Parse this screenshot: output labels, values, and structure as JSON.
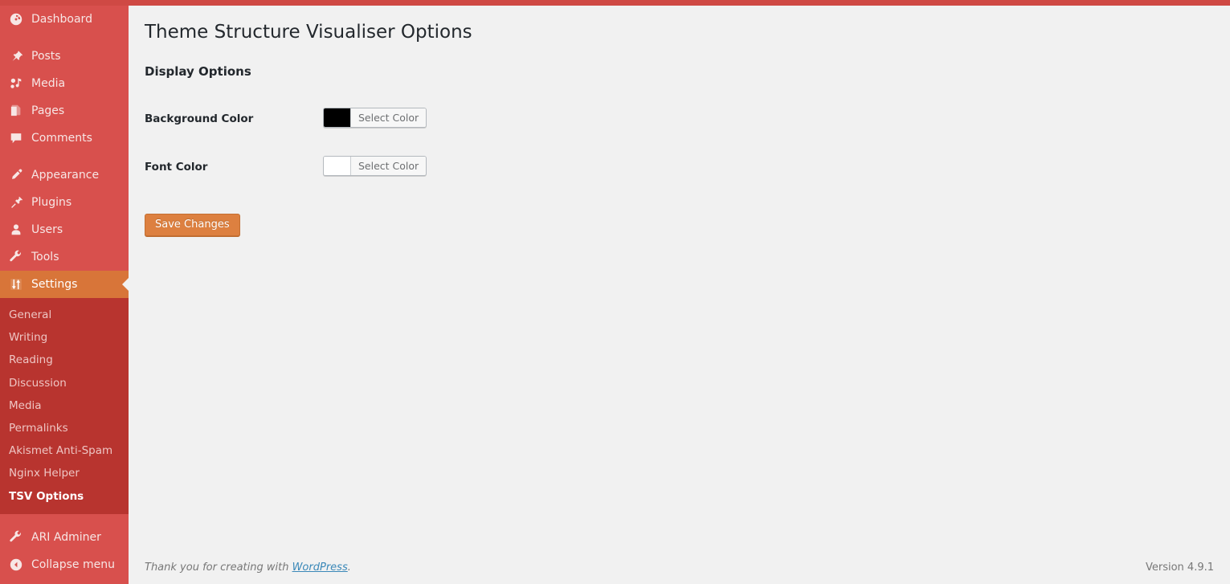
{
  "adminbar": {
    "logo_icon": "wordpress-logo-icon",
    "items_left": [
      {
        "name": "site-name",
        "icon": "home-icon"
      },
      {
        "name": "comments-bubble",
        "icon": "comment-icon"
      },
      {
        "name": "new-content",
        "icon": "plus-icon"
      }
    ],
    "items_right": [
      {
        "name": "howdy-user",
        "icon": "avatar-icon"
      }
    ]
  },
  "sidebar": {
    "items": [
      {
        "label": "Dashboard",
        "icon": "dashboard-icon",
        "name": "sidebar-item-dashboard",
        "current": false,
        "separator_after": true
      },
      {
        "label": "Posts",
        "icon": "pin-icon",
        "name": "sidebar-item-posts",
        "current": false,
        "separator_after": false
      },
      {
        "label": "Media",
        "icon": "media-icon",
        "name": "sidebar-item-media",
        "current": false,
        "separator_after": false
      },
      {
        "label": "Pages",
        "icon": "page-icon",
        "name": "sidebar-item-pages",
        "current": false,
        "separator_after": false
      },
      {
        "label": "Comments",
        "icon": "comment-icon",
        "name": "sidebar-item-comments",
        "current": false,
        "separator_after": true
      },
      {
        "label": "Appearance",
        "icon": "paintbrush-icon",
        "name": "sidebar-item-appearance",
        "current": false,
        "separator_after": false
      },
      {
        "label": "Plugins",
        "icon": "plugin-icon",
        "name": "sidebar-item-plugins",
        "current": false,
        "separator_after": false
      },
      {
        "label": "Users",
        "icon": "user-icon",
        "name": "sidebar-item-users",
        "current": false,
        "separator_after": false
      },
      {
        "label": "Tools",
        "icon": "wrench-icon",
        "name": "sidebar-item-tools",
        "current": false,
        "separator_after": false
      },
      {
        "label": "Settings",
        "icon": "settings-icon",
        "name": "sidebar-item-settings",
        "current": true,
        "separator_after": false
      }
    ],
    "submenu": [
      {
        "label": "General",
        "current": false
      },
      {
        "label": "Writing",
        "current": false
      },
      {
        "label": "Reading",
        "current": false
      },
      {
        "label": "Discussion",
        "current": false
      },
      {
        "label": "Media",
        "current": false
      },
      {
        "label": "Permalinks",
        "current": false
      },
      {
        "label": "Akismet Anti-Spam",
        "current": false
      },
      {
        "label": "Nginx Helper",
        "current": false
      },
      {
        "label": "TSV Options",
        "current": true
      }
    ],
    "bottom_items": [
      {
        "label": "ARI Adminer",
        "icon": "wrench-icon",
        "name": "sidebar-item-ari-adminer"
      },
      {
        "label": "Collapse menu",
        "icon": "collapse-left-icon",
        "name": "collapse-menu-button"
      }
    ],
    "colors": {
      "base": "#d8504d",
      "submenu_base": "#b8342f",
      "highlight": "#d87539",
      "text": "#f7e6e5",
      "submenu_text": "#eec5c3"
    }
  },
  "main": {
    "page_title": "Theme Structure Visualiser Options",
    "section_title": "Display Options",
    "fields": [
      {
        "label": "Background Color",
        "name": "background-color",
        "button_label": "Select Color",
        "swatch": "#000000"
      },
      {
        "label": "Font Color",
        "name": "font-color",
        "button_label": "Select Color",
        "swatch": "#ffffff"
      }
    ],
    "submit_label": "Save Changes",
    "submit_color": "#dd8040"
  },
  "footer": {
    "thanks_prefix": "Thank you for creating with ",
    "thanks_link": "WordPress",
    "thanks_suffix": ".",
    "version": "Version 4.9.1"
  }
}
